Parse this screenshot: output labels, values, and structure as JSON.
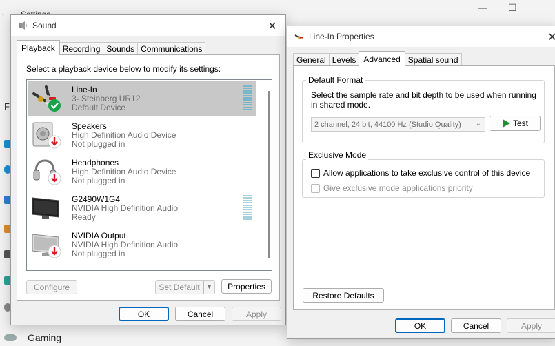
{
  "settings_bg": {
    "title": "Settings",
    "back_icon": "back-arrow-icon",
    "search_prefix": "Fi",
    "gaming_label": "Gaming",
    "window_controls": {
      "minimize": "—",
      "maximize": "☐"
    }
  },
  "sound_dialog": {
    "title": "Sound",
    "close_glyph": "✕",
    "tabs": [
      "Playback",
      "Recording",
      "Sounds",
      "Communications"
    ],
    "instruction": "Select a playback device below to modify its settings:",
    "devices": [
      {
        "name": "Line-In",
        "subtitle": "3- Steinberg UR12",
        "status": "Default Device",
        "icon": "line-in-cable-icon",
        "badge": "default-check-icon"
      },
      {
        "name": "Speakers",
        "subtitle": "High Definition Audio Device",
        "status": "Not plugged in",
        "icon": "speaker-icon",
        "badge": "unplugged-arrow-icon"
      },
      {
        "name": "Headphones",
        "subtitle": "High Definition Audio Device",
        "status": "Not plugged in",
        "icon": "headphones-icon",
        "badge": "unplugged-arrow-icon"
      },
      {
        "name": "G2490W1G4",
        "subtitle": "NVIDIA High Definition Audio",
        "status": "Ready",
        "icon": "monitor-icon",
        "badge": ""
      },
      {
        "name": "NVIDIA Output",
        "subtitle": "NVIDIA High Definition Audio",
        "status": "Not plugged in",
        "icon": "monitor-icon",
        "badge": "unplugged-arrow-icon"
      }
    ],
    "buttons": {
      "configure": "Configure",
      "set_default": "Set Default",
      "properties": "Properties",
      "ok": "OK",
      "cancel": "Cancel",
      "apply": "Apply"
    }
  },
  "props_dialog": {
    "title": "Line-In Properties",
    "close_glyph": "✕",
    "tabs": [
      "General",
      "Levels",
      "Advanced",
      "Spatial sound"
    ],
    "default_format": {
      "label": "Default Format",
      "description": "Select the sample rate and bit depth to be used when running in shared mode.",
      "selected_format": "2 channel, 24 bit, 44100 Hz (Studio Quality)",
      "test_label": "Test"
    },
    "exclusive_mode": {
      "label": "Exclusive Mode",
      "allow_exclusive": "Allow applications to take exclusive control of this device",
      "give_priority": "Give exclusive mode applications priority"
    },
    "buttons": {
      "restore_defaults": "Restore Defaults",
      "ok": "OK",
      "cancel": "Cancel",
      "apply": "Apply"
    }
  },
  "colors": {
    "selection": "#c8c8c8",
    "accent": "#0067c0",
    "check_green": "#16a34a",
    "unplugged_red": "#d71920",
    "play_green": "#1f8f2f"
  }
}
